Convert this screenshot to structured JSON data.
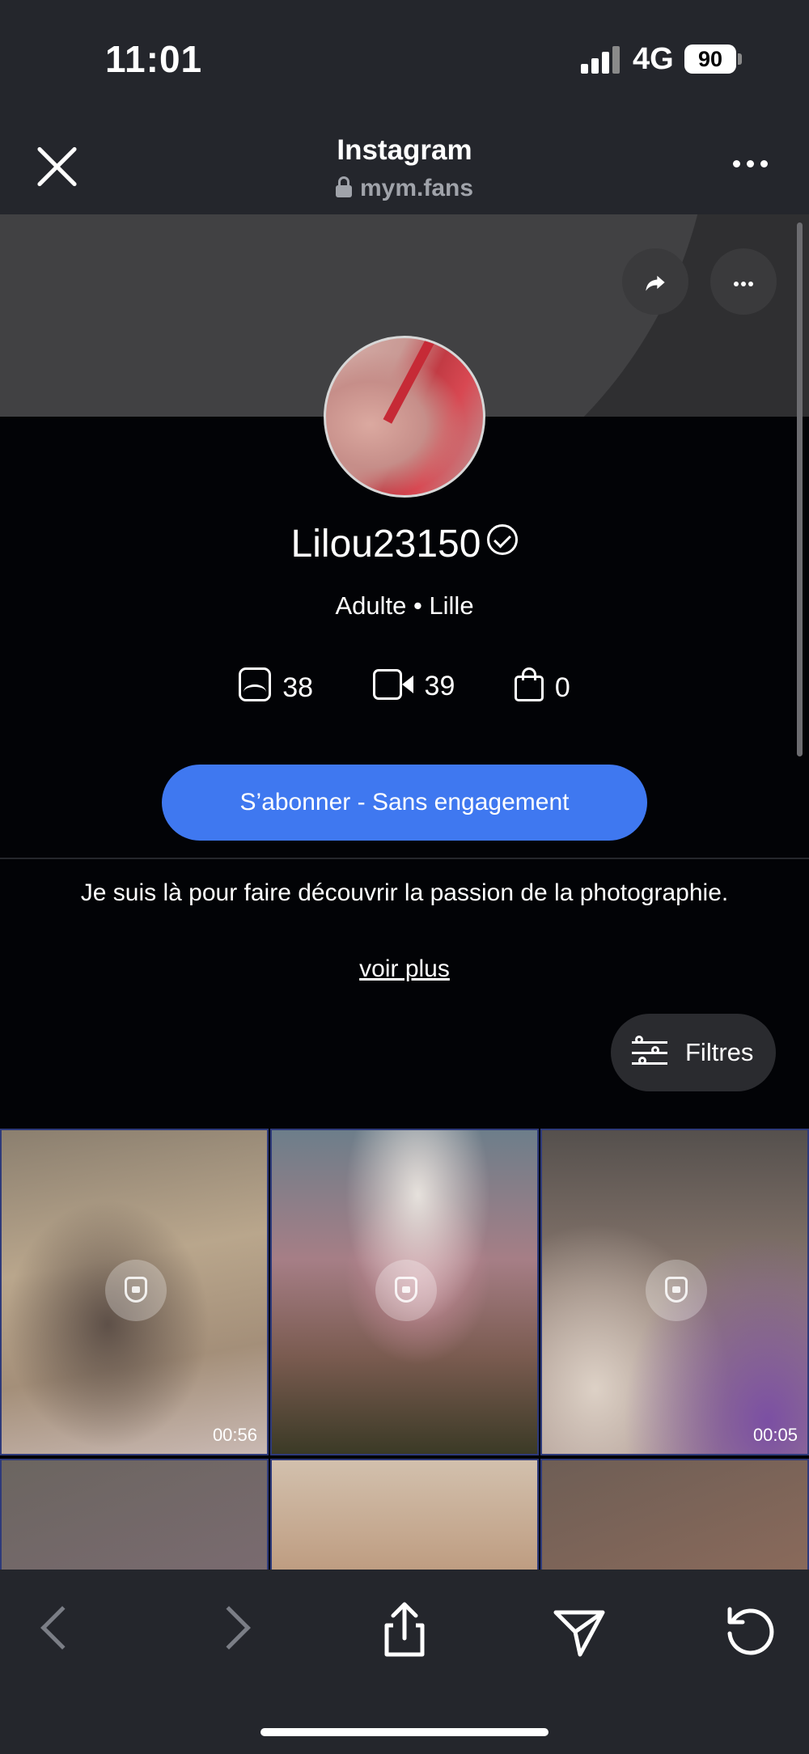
{
  "status_bar": {
    "time": "11:01",
    "network": "4G",
    "battery": "90"
  },
  "browser": {
    "title": "Instagram",
    "url": "mym.fans"
  },
  "profile": {
    "username": "Lilou23150",
    "subtitle": "Adulte • Lille",
    "stats": {
      "photos": "38",
      "videos": "39",
      "products": "0"
    },
    "subscribe_label": "S’abonner - Sans engagement",
    "bio": "Je suis là pour faire découvrir la passion de la photographie.",
    "see_more": "voir plus",
    "filters_label": "Filtres"
  },
  "media_grid": {
    "tiles": [
      {
        "duration": "00:56",
        "locked": true
      },
      {
        "duration": "",
        "locked": true
      },
      {
        "duration": "00:05",
        "locked": true
      },
      {
        "duration": "",
        "locked": false
      },
      {
        "duration": "",
        "locked": false
      },
      {
        "duration": "",
        "locked": false
      }
    ]
  },
  "colors": {
    "accent": "#3f78f0",
    "bar_bg": "#24262c",
    "page_bg": "#020306"
  },
  "icons": {
    "close": "close-icon",
    "lock": "lock-icon",
    "share": "share-icon",
    "more": "more-icon",
    "verified": "verified-badge-icon",
    "photo": "photo-icon",
    "video": "video-icon",
    "bag": "bag-icon",
    "filters": "sliders-icon",
    "upload": "upload-icon",
    "send": "send-icon",
    "reload": "reload-icon"
  }
}
